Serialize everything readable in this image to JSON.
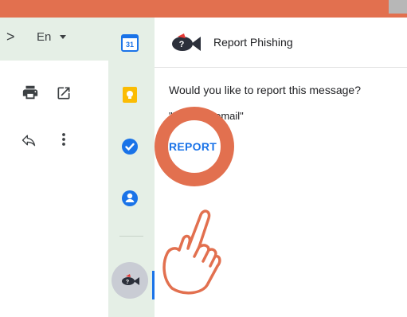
{
  "header": {
    "language": "En"
  },
  "addon": {
    "title": "Report Phishing",
    "question": "Would you like to report this message?",
    "subject": "\"Phishing email\"",
    "report_label": "REPORT"
  },
  "sidebar": {
    "items": [
      {
        "name": "calendar",
        "label": "31"
      },
      {
        "name": "keep"
      },
      {
        "name": "tasks"
      },
      {
        "name": "contacts"
      },
      {
        "name": "report-phishing"
      }
    ]
  },
  "colors": {
    "accent": "#e2704f",
    "link": "#1a73e8",
    "sidebar_bg": "#e5efe6"
  }
}
